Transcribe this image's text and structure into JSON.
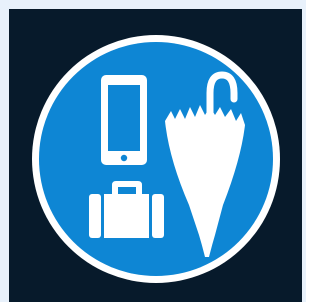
{
  "sign": {
    "icons": [
      "mobile-phone-icon",
      "suitcase-icon",
      "umbrella-icon"
    ],
    "colors": {
      "background": "#071a2b",
      "circle": "#0e86d4",
      "border": "#ffffff",
      "pictogram": "#ffffff",
      "frame": "#e8f1fb"
    }
  }
}
